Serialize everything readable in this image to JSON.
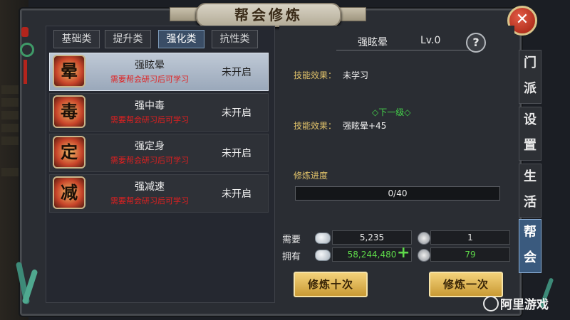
{
  "window": {
    "title": "帮会修炼",
    "close_icon": "close-icon"
  },
  "tabs": [
    {
      "label": "基础类",
      "active": false
    },
    {
      "label": "提升类",
      "active": false
    },
    {
      "label": "强化类",
      "active": true
    },
    {
      "label": "抗性类",
      "active": false
    }
  ],
  "skills": [
    {
      "icon_char": "晕",
      "name": "强眩晕",
      "requirement": "需要帮会研习后可学习",
      "status": "未开启",
      "selected": true
    },
    {
      "icon_char": "毒",
      "name": "强中毒",
      "requirement": "需要帮会研习后可学习",
      "status": "未开启",
      "selected": false
    },
    {
      "icon_char": "定",
      "name": "强定身",
      "requirement": "需要帮会研习后可学习",
      "status": "未开启",
      "selected": false
    },
    {
      "icon_char": "减",
      "name": "强减速",
      "requirement": "需要帮会研习后可学习",
      "status": "未开启",
      "selected": false
    }
  ],
  "detail": {
    "skill_name": "强眩晕",
    "level": "Lv.0",
    "help_icon": "question-icon",
    "effect_label": "技能效果：",
    "effect_value": "未学习",
    "next_level_label": "◇下一级◇",
    "next_effect_label": "技能效果：",
    "next_effect_value": "强眩晕+45",
    "progress_label": "修炼进度",
    "progress_text": "0/40",
    "progress_fraction": 0
  },
  "resources": {
    "need_label": "需要",
    "have_label": "拥有",
    "need_coin": "5,235",
    "need_item": "1",
    "have_coin": "58,244,480",
    "have_item": "79",
    "coin_icon": "silver-coin-icon",
    "item_icon": "contribution-token-icon",
    "plus_icon": "plus-icon"
  },
  "buttons": {
    "train_ten": "修炼十次",
    "train_once": "修炼一次"
  },
  "side_tabs": [
    {
      "chars": [
        "门",
        "派"
      ],
      "active": false
    },
    {
      "chars": [
        "设",
        "置"
      ],
      "active": false
    },
    {
      "chars": [
        "生",
        "活"
      ],
      "active": false
    },
    {
      "chars": [
        "帮",
        "会"
      ],
      "active": true
    }
  ],
  "watermark": "阿里游戏",
  "colors": {
    "accent_gold": "#e3c46b",
    "requirement_red": "#e02020",
    "next_level_green": "#44d24a",
    "have_coin_green": "#5ed94a",
    "active_tab_blue": "#3a4d66"
  }
}
